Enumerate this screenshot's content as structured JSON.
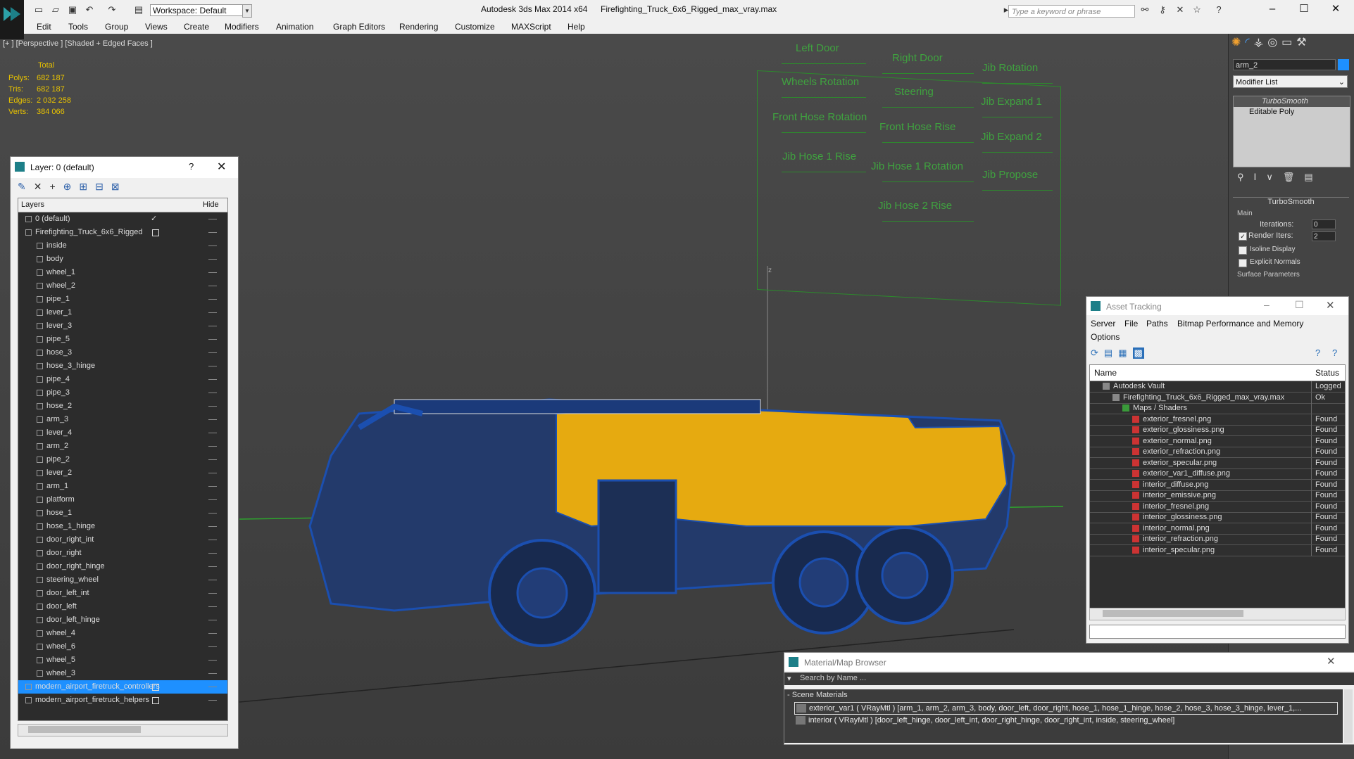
{
  "titlebar": {
    "workspace": "Workspace: Default",
    "app": "Autodesk 3ds Max  2014 x64",
    "file": "Firefighting_Truck_6x6_Rigged_max_vray.max",
    "search_placeholder": "Type a keyword or phrase"
  },
  "menu": [
    "Edit",
    "Tools",
    "Group",
    "Views",
    "Create",
    "Modifiers",
    "Animation",
    "Graph Editors",
    "Rendering",
    "Customize",
    "MAXScript",
    "Help"
  ],
  "viewport": {
    "label": "[+ ] [Perspective ] [Shaded + Edged Faces ]",
    "stats": {
      "total_label": "Total",
      "rows": [
        {
          "label": "Polys:",
          "value": "682 187"
        },
        {
          "label": "Tris:",
          "value": "682 187"
        },
        {
          "label": "Edges:",
          "value": "2 032 258"
        },
        {
          "label": "Verts:",
          "value": "384 066"
        }
      ]
    },
    "axis_label": "z",
    "controls": [
      "Left Door",
      "Right Door",
      "Jib Rotation",
      "Wheels Rotation",
      "Steering",
      "Jib Expand 1",
      "Front Hose Rotation",
      "Front Hose Rise",
      "Jib Expand 2",
      "Jib Hose 1 Rise",
      "Jib Hose 1 Rotation",
      "Jib Propose",
      "Jib Hose 2 Rise"
    ]
  },
  "layer_window": {
    "title": "Layer: 0 (default)",
    "help": "?",
    "col_layers": "Layers",
    "col_hide": "Hide",
    "rows": [
      {
        "name": "0 (default)",
        "level": 0,
        "checked": true
      },
      {
        "name": "Firefighting_Truck_6x6_Rigged",
        "level": 0,
        "box": true
      },
      {
        "name": "inside",
        "level": 1
      },
      {
        "name": "body",
        "level": 1
      },
      {
        "name": "wheel_1",
        "level": 1
      },
      {
        "name": "wheel_2",
        "level": 1
      },
      {
        "name": "pipe_1",
        "level": 1
      },
      {
        "name": "lever_1",
        "level": 1
      },
      {
        "name": "lever_3",
        "level": 1
      },
      {
        "name": "pipe_5",
        "level": 1
      },
      {
        "name": "hose_3",
        "level": 1
      },
      {
        "name": "hose_3_hinge",
        "level": 1
      },
      {
        "name": "pipe_4",
        "level": 1
      },
      {
        "name": "pipe_3",
        "level": 1
      },
      {
        "name": "hose_2",
        "level": 1
      },
      {
        "name": "arm_3",
        "level": 1
      },
      {
        "name": "lever_4",
        "level": 1
      },
      {
        "name": "arm_2",
        "level": 1
      },
      {
        "name": "pipe_2",
        "level": 1
      },
      {
        "name": "lever_2",
        "level": 1
      },
      {
        "name": "arm_1",
        "level": 1
      },
      {
        "name": "platform",
        "level": 1
      },
      {
        "name": "hose_1",
        "level": 1
      },
      {
        "name": "hose_1_hinge",
        "level": 1
      },
      {
        "name": "door_right_int",
        "level": 1
      },
      {
        "name": "door_right",
        "level": 1
      },
      {
        "name": "door_right_hinge",
        "level": 1
      },
      {
        "name": "steering_wheel",
        "level": 1
      },
      {
        "name": "door_left_int",
        "level": 1
      },
      {
        "name": "door_left",
        "level": 1
      },
      {
        "name": "door_left_hinge",
        "level": 1
      },
      {
        "name": "wheel_4",
        "level": 1
      },
      {
        "name": "wheel_6",
        "level": 1
      },
      {
        "name": "wheel_5",
        "level": 1
      },
      {
        "name": "wheel_3",
        "level": 1
      },
      {
        "name": "modern_airport_firetruck_controllers",
        "level": 0,
        "selected": true,
        "box": true
      },
      {
        "name": "modern_airport_firetruck_helpers",
        "level": 0,
        "box": true
      }
    ]
  },
  "command_panel": {
    "object_name": "arm_2",
    "modifier_list": "Modifier List",
    "stack": [
      "TurboSmooth",
      "Editable Poly"
    ],
    "rollout_title": "TurboSmooth",
    "main_label": "Main",
    "iterations_label": "Iterations:",
    "iterations_value": "0",
    "render_iters_label": "Render Iters:",
    "render_iters_value": "2",
    "isoline": "Isoline Display",
    "explicit": "Explicit Normals",
    "surface": "Surface Parameters"
  },
  "asset_tracking": {
    "title": "Asset Tracking",
    "menu": [
      "Server",
      "File",
      "Paths",
      "Bitmap Performance and Memory"
    ],
    "menu2": "Options",
    "col_name": "Name",
    "col_status": "Status",
    "rows": [
      {
        "name": "Autodesk Vault",
        "status": "Logged",
        "level": 0
      },
      {
        "name": "Firefighting_Truck_6x6_Rigged_max_vray.max",
        "status": "Ok",
        "level": 1
      },
      {
        "name": "Maps / Shaders",
        "status": "",
        "level": 2
      },
      {
        "name": "exterior_fresnel.png",
        "status": "Found",
        "level": 3
      },
      {
        "name": "exterior_glossiness.png",
        "status": "Found",
        "level": 3
      },
      {
        "name": "exterior_normal.png",
        "status": "Found",
        "level": 3
      },
      {
        "name": "exterior_refraction.png",
        "status": "Found",
        "level": 3
      },
      {
        "name": "exterior_specular.png",
        "status": "Found",
        "level": 3
      },
      {
        "name": "exterior_var1_diffuse.png",
        "status": "Found",
        "level": 3
      },
      {
        "name": "interior_diffuse.png",
        "status": "Found",
        "level": 3
      },
      {
        "name": "interior_emissive.png",
        "status": "Found",
        "level": 3
      },
      {
        "name": "interior_fresnel.png",
        "status": "Found",
        "level": 3
      },
      {
        "name": "interior_glossiness.png",
        "status": "Found",
        "level": 3
      },
      {
        "name": "interior_normal.png",
        "status": "Found",
        "level": 3
      },
      {
        "name": "interior_refraction.png",
        "status": "Found",
        "level": 3
      },
      {
        "name": "interior_specular.png",
        "status": "Found",
        "level": 3
      }
    ]
  },
  "material_browser": {
    "title": "Material/Map Browser",
    "search": "Search by Name ...",
    "section": "- Scene Materials",
    "items": [
      "exterior_var1  ( VRayMtl ) [arm_1, arm_2, arm_3, body, door_left, door_right, hose_1, hose_1_hinge, hose_2, hose_3, hose_3_hinge, lever_1,...",
      "interior ( VRayMtl ) [door_left_hinge, door_left_int, door_right_hinge, door_right_int, inside, steering_wheel]"
    ]
  },
  "colors": {
    "accent": "#1e90ff",
    "wire": "#1b4fb0",
    "body": "#e6aa10",
    "green": "#3fa33f"
  }
}
